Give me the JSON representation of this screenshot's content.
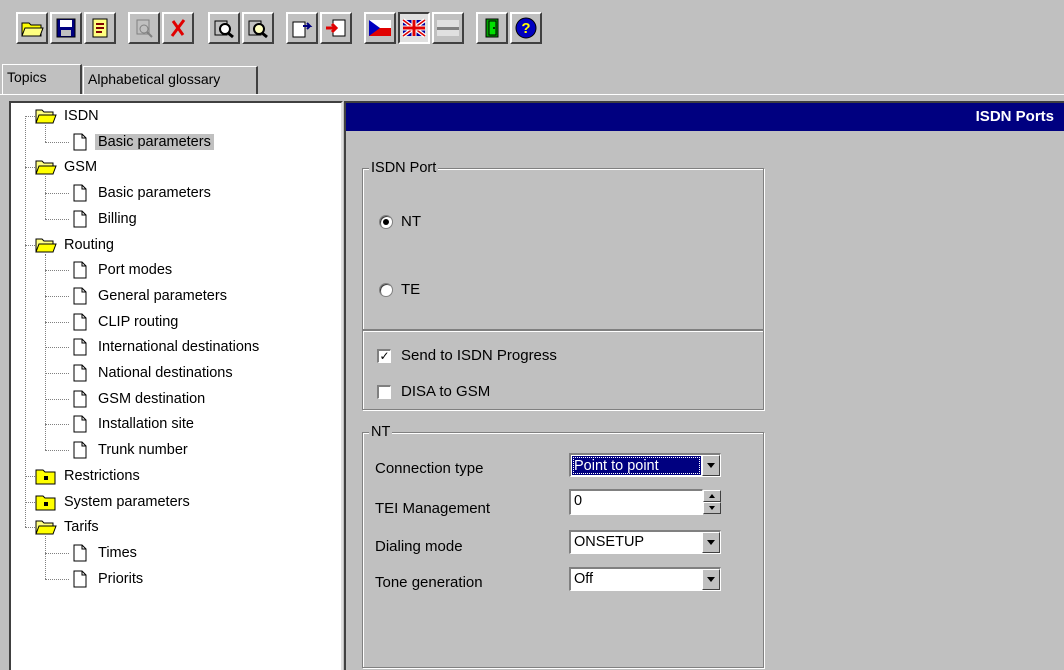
{
  "toolbar": {
    "buttons": [
      {
        "icon": "open-folder-icon"
      },
      {
        "icon": "save-disk-icon"
      },
      {
        "icon": "document-icon"
      },
      {
        "icon": "disabled-device-icon"
      },
      {
        "icon": "delete-x-icon"
      },
      {
        "icon": "device-search-icon"
      },
      {
        "icon": "device-search-alt-icon"
      },
      {
        "icon": "export-icon"
      },
      {
        "icon": "import-icon"
      },
      {
        "icon": "flag-czech-icon"
      },
      {
        "icon": "flag-uk-icon"
      },
      {
        "icon": "flag-gray-icon"
      },
      {
        "icon": "exit-door-icon"
      },
      {
        "icon": "help-icon"
      }
    ]
  },
  "tabs": [
    "Topics",
    "Alphabetical glossary"
  ],
  "tree": {
    "items": [
      {
        "label": "ISDN",
        "level": 0,
        "type": "folder-open"
      },
      {
        "label": "Basic parameters",
        "level": 1,
        "type": "doc",
        "selected": true
      },
      {
        "label": "GSM",
        "level": 0,
        "type": "folder-open"
      },
      {
        "label": "Basic parameters",
        "level": 1,
        "type": "doc"
      },
      {
        "label": "Billing",
        "level": 1,
        "type": "doc"
      },
      {
        "label": "Routing",
        "level": 0,
        "type": "folder-open"
      },
      {
        "label": "Port modes",
        "level": 1,
        "type": "doc"
      },
      {
        "label": "General parameters",
        "level": 1,
        "type": "doc"
      },
      {
        "label": "CLIP routing",
        "level": 1,
        "type": "doc"
      },
      {
        "label": "International destinations",
        "level": 1,
        "type": "doc"
      },
      {
        "label": "National destinations",
        "level": 1,
        "type": "doc"
      },
      {
        "label": "GSM destination",
        "level": 1,
        "type": "doc"
      },
      {
        "label": "Installation site",
        "level": 1,
        "type": "doc"
      },
      {
        "label": "Trunk number",
        "level": 1,
        "type": "doc"
      },
      {
        "label": "Restrictions",
        "level": 0,
        "type": "folder-closed"
      },
      {
        "label": "System parameters",
        "level": 0,
        "type": "folder-closed"
      },
      {
        "label": "Tarifs",
        "level": 0,
        "type": "folder-open"
      },
      {
        "label": "Times",
        "level": 1,
        "type": "doc"
      },
      {
        "label": "Priorits",
        "level": 1,
        "type": "doc"
      }
    ]
  },
  "panel": {
    "title": "ISDN Ports",
    "isdn_port_group": {
      "title": "ISDN Port",
      "nt_label": "NT",
      "te_label": "TE",
      "selected": "NT"
    },
    "checks": {
      "send_progress_label": "Send to ISDN Progress",
      "send_progress_checked": true,
      "disa_label": "DISA to GSM",
      "disa_checked": false
    },
    "nt_group": {
      "title": "NT",
      "connection_type_label": "Connection type",
      "connection_type_value": "Point to point",
      "tei_label": "TEI Management",
      "tei_value": "0",
      "dialing_label": "Dialing mode",
      "dialing_value": "ONSETUP",
      "tone_label": "Tone generation",
      "tone_value": "Off"
    }
  }
}
